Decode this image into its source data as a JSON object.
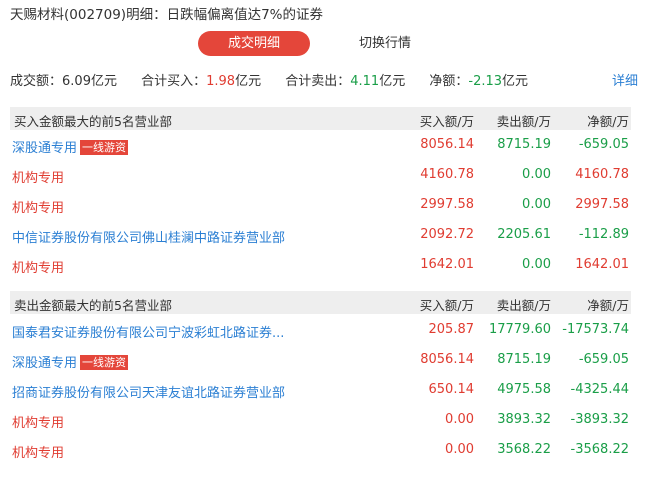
{
  "title": "天赐材料(002709)明细：日跌幅偏离值达7%的证券",
  "tabs": [
    {
      "label": "成交明细",
      "active": true
    },
    {
      "label": "切换行情",
      "active": false
    }
  ],
  "summary": {
    "turnover_label": "成交额：",
    "turnover_value": "6.09亿元",
    "buy_label": "合计买入：",
    "buy_value": "1.98",
    "buy_unit": "亿元",
    "sell_label": "合计卖出：",
    "sell_value": "4.11",
    "sell_unit": "亿元",
    "net_label": "净额：",
    "net_value": "-2.13",
    "net_unit": "亿元",
    "detail_link": "详细"
  },
  "colors": {
    "accent": "#e4463a",
    "up": "#e03c31",
    "down": "#1a9e48",
    "link": "#2b7fd3"
  },
  "buy_section": {
    "title": "买入金额最大的前5名营业部",
    "col_buy": "买入额/万",
    "col_sell": "卖出额/万",
    "col_net": "净额/万",
    "rows": [
      {
        "name": "深股通专用",
        "badge": "一线游资",
        "buy": "8056.14",
        "sell": "8715.19",
        "net": "-659.05"
      },
      {
        "name": "机构专用",
        "badge": "",
        "buy": "4160.78",
        "sell": "0.00",
        "net": "4160.78"
      },
      {
        "name": "机构专用",
        "badge": "",
        "buy": "2997.58",
        "sell": "0.00",
        "net": "2997.58"
      },
      {
        "name": "中信证券股份有限公司佛山桂澜中路证券营业部",
        "badge": "",
        "buy": "2092.72",
        "sell": "2205.61",
        "net": "-112.89"
      },
      {
        "name": "机构专用",
        "badge": "",
        "buy": "1642.01",
        "sell": "0.00",
        "net": "1642.01"
      }
    ]
  },
  "sell_section": {
    "title": "卖出金额最大的前5名营业部",
    "col_buy": "买入额/万",
    "col_sell": "卖出额/万",
    "col_net": "净额/万",
    "rows": [
      {
        "name": "国泰君安证券股份有限公司宁波彩虹北路证券...",
        "badge": "",
        "buy": "205.87",
        "sell": "17779.60",
        "net": "-17573.74"
      },
      {
        "name": "深股通专用",
        "badge": "一线游资",
        "buy": "8056.14",
        "sell": "8715.19",
        "net": "-659.05"
      },
      {
        "name": "招商证券股份有限公司天津友谊北路证券营业部",
        "badge": "",
        "buy": "650.14",
        "sell": "4975.58",
        "net": "-4325.44"
      },
      {
        "name": "机构专用",
        "badge": "",
        "buy": "0.00",
        "sell": "3893.32",
        "net": "-3893.32"
      },
      {
        "name": "机构专用",
        "badge": "",
        "buy": "0.00",
        "sell": "3568.22",
        "net": "-3568.22"
      }
    ]
  }
}
